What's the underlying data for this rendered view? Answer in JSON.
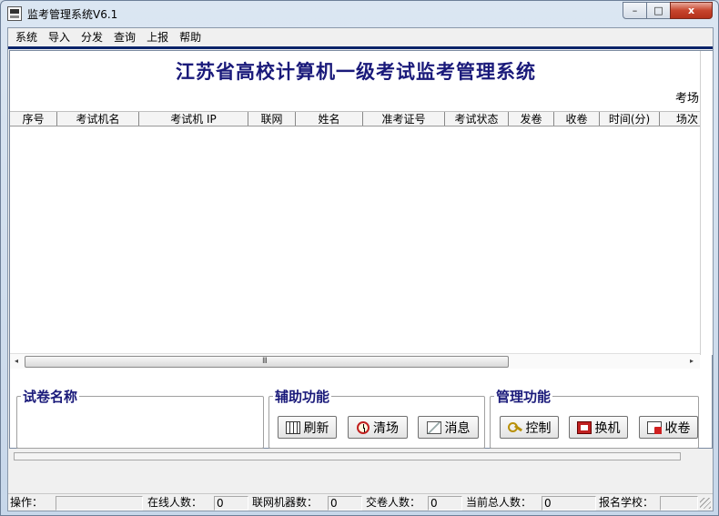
{
  "window": {
    "title": "监考管理系统V6.1",
    "controls": {
      "minimize": "–",
      "maximize": "□",
      "close": "x"
    }
  },
  "menu": [
    "系统",
    "导入",
    "分发",
    "查询",
    "上报",
    "帮助"
  ],
  "header": {
    "title": "江苏省高校计算机一级考试监考管理系统",
    "room_label": "考场"
  },
  "table": {
    "columns": [
      "序号",
      "考试机名",
      "考试机 IP",
      "联网",
      "姓名",
      "准考证号",
      "考试状态",
      "发卷",
      "收卷",
      "时间(分)",
      "场次"
    ],
    "rows": []
  },
  "scrollbar": {
    "grip": "III",
    "left_arrow": "◂",
    "right_arrow": "▸"
  },
  "panels": {
    "paper_name": {
      "title": "试卷名称"
    },
    "auxiliary": {
      "title": "辅助功能",
      "buttons": [
        {
          "label": "刷新",
          "icon": "refresh-grid-icon"
        },
        {
          "label": "清场",
          "icon": "clock-icon"
        },
        {
          "label": "消息",
          "icon": "message-icon"
        }
      ]
    },
    "management": {
      "title": "管理功能",
      "buttons": [
        {
          "label": "控制",
          "icon": "key-icon"
        },
        {
          "label": "换机",
          "icon": "swap-machine-icon"
        },
        {
          "label": "收卷",
          "icon": "collect-papers-icon"
        }
      ]
    }
  },
  "statusbar": {
    "operation_label": "操作：",
    "operation_value": "",
    "online_label": "在线人数：",
    "online_value": "0",
    "networked_label": "联网机器数：",
    "networked_value": "0",
    "submitted_label": "交卷人数：",
    "submitted_value": "0",
    "total_label": "当前总人数：",
    "total_value": "0",
    "school_label": "报名学校：",
    "school_value": ""
  }
}
